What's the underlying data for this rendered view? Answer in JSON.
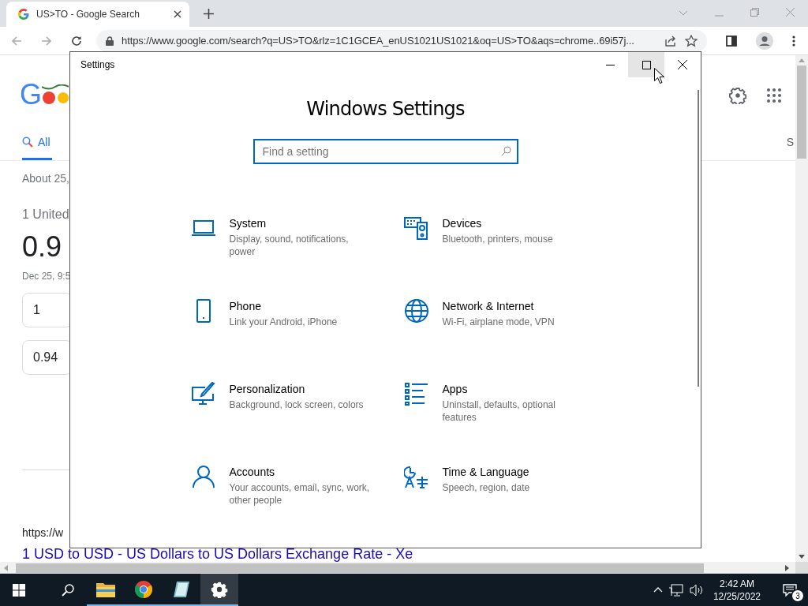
{
  "browser": {
    "tab": {
      "title": "US>TO - Google Search"
    },
    "url": "https://www.google.com/search?q=US>TO&rlz=1C1GCEA_enUS1021US1021&oq=US>TO&aqs=chrome..69i57j..."
  },
  "page": {
    "logo": "G",
    "tabs": [
      {
        "label": "All",
        "selected": true
      }
    ],
    "right_tab": "S",
    "result_stats": "About 25,",
    "conversion_label": "1 United",
    "conversion_value": "0.9",
    "timestamp": "Dec 25, 9:5",
    "inputs": [
      {
        "value": "1"
      },
      {
        "value": "0.94"
      }
    ],
    "result_url": "https://w",
    "result_title": "1 USD to USD - US Dollars to US Dollars Exchange Rate - Xe"
  },
  "settings": {
    "title": "Settings",
    "controls": [
      {
        "kind": "minimize",
        "hovered": false
      },
      {
        "kind": "maximize",
        "hovered": true
      },
      {
        "kind": "close",
        "hovered": false
      }
    ],
    "heading": "Windows Settings",
    "search": {
      "placeholder": "Find a setting"
    },
    "categories": [
      {
        "kind": "system",
        "name": "System",
        "description": "Display, sound, notifications, power"
      },
      {
        "kind": "devices",
        "name": "Devices",
        "description": "Bluetooth, printers, mouse"
      },
      {
        "kind": "phone",
        "name": "Phone",
        "description": "Link your Android, iPhone"
      },
      {
        "kind": "network",
        "name": "Network & Internet",
        "description": "Wi-Fi, airplane mode, VPN"
      },
      {
        "kind": "personalization",
        "name": "Personalization",
        "description": "Background, lock screen, colors"
      },
      {
        "kind": "apps",
        "name": "Apps",
        "description": "Uninstall, defaults, optional features"
      },
      {
        "kind": "accounts",
        "name": "Accounts",
        "description": "Your accounts, email, sync, work, other people"
      },
      {
        "kind": "time",
        "name": "Time & Language",
        "description": "Speech, region, date"
      }
    ]
  },
  "taskbar": {
    "apps": [
      {
        "kind": "explorer",
        "running": true,
        "selected": false
      },
      {
        "kind": "chrome",
        "running": true,
        "selected": false
      },
      {
        "kind": "notes",
        "running": true,
        "selected": false
      },
      {
        "kind": "settings",
        "running": true,
        "selected": true
      }
    ],
    "time": "2:42 AM",
    "date": "12/25/2022",
    "notifications": "3"
  }
}
